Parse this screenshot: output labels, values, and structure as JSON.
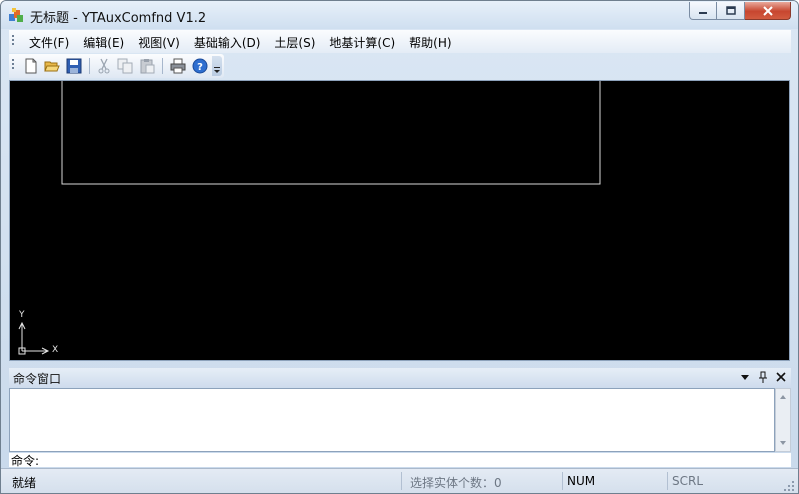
{
  "window": {
    "title": "无标题 - YTAuxComfnd V1.2"
  },
  "menu": {
    "items": [
      {
        "label": "文件(F)"
      },
      {
        "label": "编辑(E)"
      },
      {
        "label": "视图(V)"
      },
      {
        "label": "基础输入(D)"
      },
      {
        "label": "土层(S)"
      },
      {
        "label": "地基计算(C)"
      },
      {
        "label": "帮助(H)"
      }
    ]
  },
  "toolbar": {
    "buttons": [
      "new-file-icon",
      "open-folder-icon",
      "save-icon",
      "cut-icon",
      "copy-icon",
      "paste-icon",
      "print-icon",
      "help-icon"
    ]
  },
  "canvas": {
    "background": "#000000",
    "axis_labels": {
      "x": "X",
      "y": "Y"
    }
  },
  "command_window": {
    "title": "命令窗口",
    "prompt": "命令:",
    "input_value": "",
    "output_text": ""
  },
  "status": {
    "ready": "就绪",
    "selection_count": "选择实体个数：0",
    "num": "NUM",
    "scrl": "SCRL"
  },
  "colors": {
    "canvas": "#000000",
    "close_button": "#c7462f",
    "chrome": "#d4e0ee"
  }
}
